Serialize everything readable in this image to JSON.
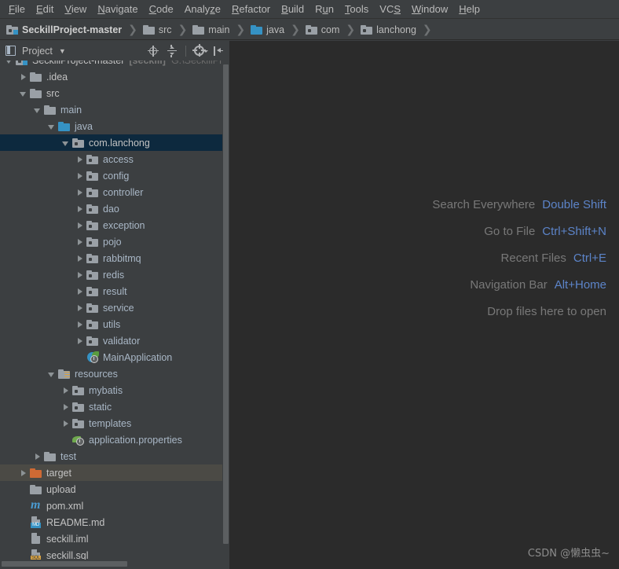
{
  "menubar": {
    "items": [
      {
        "label": "File",
        "mnemonic_index": 0
      },
      {
        "label": "Edit",
        "mnemonic_index": 0
      },
      {
        "label": "View",
        "mnemonic_index": 0
      },
      {
        "label": "Navigate",
        "mnemonic_index": 0
      },
      {
        "label": "Code",
        "mnemonic_index": 0
      },
      {
        "label": "Analyze",
        "mnemonic_index": 5
      },
      {
        "label": "Refactor",
        "mnemonic_index": 0
      },
      {
        "label": "Build",
        "mnemonic_index": 0
      },
      {
        "label": "Run",
        "mnemonic_index": 1
      },
      {
        "label": "Tools",
        "mnemonic_index": 0
      },
      {
        "label": "VCS",
        "mnemonic_index": 2
      },
      {
        "label": "Window",
        "mnemonic_index": 0
      },
      {
        "label": "Help",
        "mnemonic_index": 0
      }
    ]
  },
  "navbar": {
    "crumbs": [
      {
        "label": "SeckillProject-master",
        "icon": "project-folder-icon",
        "style": "project"
      },
      {
        "label": "src",
        "icon": "folder-icon",
        "style": "plain"
      },
      {
        "label": "main",
        "icon": "folder-icon",
        "style": "plain"
      },
      {
        "label": "java",
        "icon": "source-folder-icon",
        "style": "blue"
      },
      {
        "label": "com",
        "icon": "package-icon",
        "style": "package"
      },
      {
        "label": "lanchong",
        "icon": "package-icon",
        "style": "package"
      }
    ],
    "separator": "❯"
  },
  "tool_window": {
    "title": "Project",
    "caret": "▼",
    "actions": [
      {
        "name": "select-opened-file-icon",
        "tooltip": "Select Opened File"
      },
      {
        "name": "collapse-all-icon",
        "tooltip": "Collapse All"
      },
      {
        "name": "settings-gear-icon",
        "tooltip": "Settings"
      },
      {
        "name": "hide-window-icon",
        "tooltip": "Hide"
      }
    ]
  },
  "tree": {
    "rows": [
      {
        "label": "SeckillProject-master",
        "sub": "[seckill]",
        "path": "G:\\SeckillProj",
        "depth": 0,
        "twisty": "down",
        "icon": "project-folder-icon",
        "state": "normal"
      },
      {
        "label": ".idea",
        "depth": 1,
        "twisty": "right",
        "icon": "folder-icon",
        "state": "normal"
      },
      {
        "label": "src",
        "depth": 1,
        "twisty": "down",
        "icon": "folder-icon",
        "state": "normal"
      },
      {
        "label": "main",
        "depth": 2,
        "twisty": "down",
        "icon": "folder-icon",
        "state": "normal"
      },
      {
        "label": "java",
        "depth": 3,
        "twisty": "down",
        "icon": "source-folder-icon",
        "state": "normal"
      },
      {
        "label": "com.lanchong",
        "depth": 4,
        "twisty": "down",
        "icon": "package-icon",
        "state": "selected"
      },
      {
        "label": "access",
        "depth": 5,
        "twisty": "right",
        "icon": "package-icon",
        "state": "normal"
      },
      {
        "label": "config",
        "depth": 5,
        "twisty": "right",
        "icon": "package-icon",
        "state": "normal"
      },
      {
        "label": "controller",
        "depth": 5,
        "twisty": "right",
        "icon": "package-icon",
        "state": "normal"
      },
      {
        "label": "dao",
        "depth": 5,
        "twisty": "right",
        "icon": "package-icon",
        "state": "normal"
      },
      {
        "label": "exception",
        "depth": 5,
        "twisty": "right",
        "icon": "package-icon",
        "state": "normal"
      },
      {
        "label": "pojo",
        "depth": 5,
        "twisty": "right",
        "icon": "package-icon",
        "state": "normal"
      },
      {
        "label": "rabbitmq",
        "depth": 5,
        "twisty": "right",
        "icon": "package-icon",
        "state": "normal"
      },
      {
        "label": "redis",
        "depth": 5,
        "twisty": "right",
        "icon": "package-icon",
        "state": "normal"
      },
      {
        "label": "result",
        "depth": 5,
        "twisty": "right",
        "icon": "package-icon",
        "state": "normal"
      },
      {
        "label": "service",
        "depth": 5,
        "twisty": "right",
        "icon": "package-icon",
        "state": "normal"
      },
      {
        "label": "utils",
        "depth": 5,
        "twisty": "right",
        "icon": "package-icon",
        "state": "normal"
      },
      {
        "label": "validator",
        "depth": 5,
        "twisty": "right",
        "icon": "package-icon",
        "state": "normal"
      },
      {
        "label": "MainApplication",
        "depth": 5,
        "twisty": "none",
        "icon": "spring-application-icon",
        "state": "normal"
      },
      {
        "label": "resources",
        "depth": 3,
        "twisty": "down",
        "icon": "resources-folder-icon",
        "state": "normal"
      },
      {
        "label": "mybatis",
        "depth": 4,
        "twisty": "right",
        "icon": "package-icon",
        "state": "normal"
      },
      {
        "label": "static",
        "depth": 4,
        "twisty": "right",
        "icon": "package-icon",
        "state": "normal"
      },
      {
        "label": "templates",
        "depth": 4,
        "twisty": "right",
        "icon": "package-icon",
        "state": "normal"
      },
      {
        "label": "application.properties",
        "depth": 4,
        "twisty": "none",
        "icon": "spring-properties-icon",
        "state": "normal"
      },
      {
        "label": "test",
        "depth": 2,
        "twisty": "right",
        "icon": "folder-icon",
        "state": "normal"
      },
      {
        "label": "target",
        "depth": 1,
        "twisty": "right",
        "icon": "excluded-folder-icon",
        "state": "hovered"
      },
      {
        "label": "upload",
        "depth": 1,
        "twisty": "none",
        "icon": "folder-icon",
        "state": "normal"
      },
      {
        "label": "pom.xml",
        "depth": 1,
        "twisty": "none",
        "icon": "maven-file-icon",
        "state": "normal"
      },
      {
        "label": "README.md",
        "depth": 1,
        "twisty": "none",
        "icon": "markdown-file-icon",
        "state": "normal"
      },
      {
        "label": "seckill.iml",
        "depth": 1,
        "twisty": "none",
        "icon": "module-file-icon",
        "state": "normal"
      },
      {
        "label": "seckill.sql",
        "depth": 1,
        "twisty": "none",
        "icon": "sql-file-icon",
        "state": "normal"
      }
    ]
  },
  "editor": {
    "hints": [
      {
        "label": "Search Everywhere",
        "key": "Double Shift"
      },
      {
        "label": "Go to File",
        "key": "Ctrl+Shift+N"
      },
      {
        "label": "Recent Files",
        "key": "Ctrl+E"
      },
      {
        "label": "Navigation Bar",
        "key": "Alt+Home"
      },
      {
        "label": "Drop files here to open",
        "key": ""
      }
    ],
    "watermark": "CSDN @懒虫虫~"
  },
  "colors": {
    "panel_bg": "#3c3f41",
    "editor_bg": "#2b2b2b",
    "selection_bg": "#0d293e",
    "hover_bg": "#4b4a45",
    "text": "#a9b7c6",
    "muted_text": "#787878",
    "accent_blue": "#5c84c9",
    "folder_blue": "#3592c4",
    "excluded_orange": "#cf6a34"
  }
}
